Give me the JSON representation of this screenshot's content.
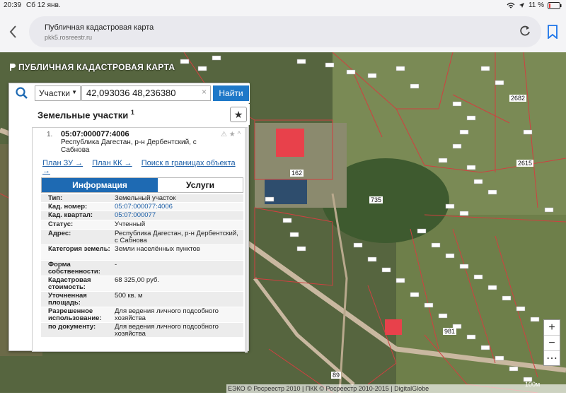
{
  "status_bar": {
    "time": "20:39",
    "date": "Сб 12 янв.",
    "battery": "11 %"
  },
  "browser": {
    "page_title": "Публичная кадастровая карта",
    "url": "pkk5.rosreestr.ru"
  },
  "map": {
    "app_title": "ПУБЛИЧНАЯ КАДАСТРОВАЯ КАРТА",
    "parcel_labels": [
      "2682",
      "2615",
      "735",
      "162",
      "89",
      "981"
    ],
    "attribution": "ЕЭКО © Росреестр 2010 | ПКК © Росреестр 2010-2015 | DigitalGlobe",
    "scale": "100м",
    "zoom_in": "+",
    "zoom_out": "−",
    "extra": "⋯"
  },
  "search": {
    "type_select": "Участки",
    "query": "42,093036 48,236380",
    "clear": "×",
    "button": "Найти"
  },
  "section": {
    "title": "Земельные участки",
    "superscript": "1",
    "star": "★"
  },
  "result": {
    "index": "1.",
    "cadastral_number": "05:07:000077:4006",
    "address": "Республика Дагестан, р-н Дербентский, с Сабнова",
    "icons": "⚠ ★ ^",
    "links": [
      "План ЗУ →",
      "План КК →",
      "Поиск в границах объекта →"
    ],
    "tabs": [
      "Информация",
      "Услуги"
    ],
    "fields": [
      {
        "key": "Тип:",
        "value": "Земельный участок"
      },
      {
        "key": "Кад. номер:",
        "value": "05:07:000077:4006"
      },
      {
        "key": "Кад. квартал:",
        "value": "05:07:000077"
      },
      {
        "key": "Статус:",
        "value": "Учтенный"
      },
      {
        "key": "Адрес:",
        "value": "Республика Дагестан, р-н Дербентский, с Сабнова"
      },
      {
        "key": "Категория земель:",
        "value": "Земли населённых пунктов"
      },
      {
        "key": "Форма собственности:",
        "value": "-"
      },
      {
        "key": "Кадастровая стоимость:",
        "value": "68 325,00 руб."
      },
      {
        "key": "Уточненная площадь:",
        "value": "500 кв. м"
      },
      {
        "key": "Разрешенное использование:",
        "value": "Для ведения личного подсобного хозяйства"
      },
      {
        "key": "по документу:",
        "value": "Для ведения личного подсобного хозяйства"
      }
    ]
  }
}
